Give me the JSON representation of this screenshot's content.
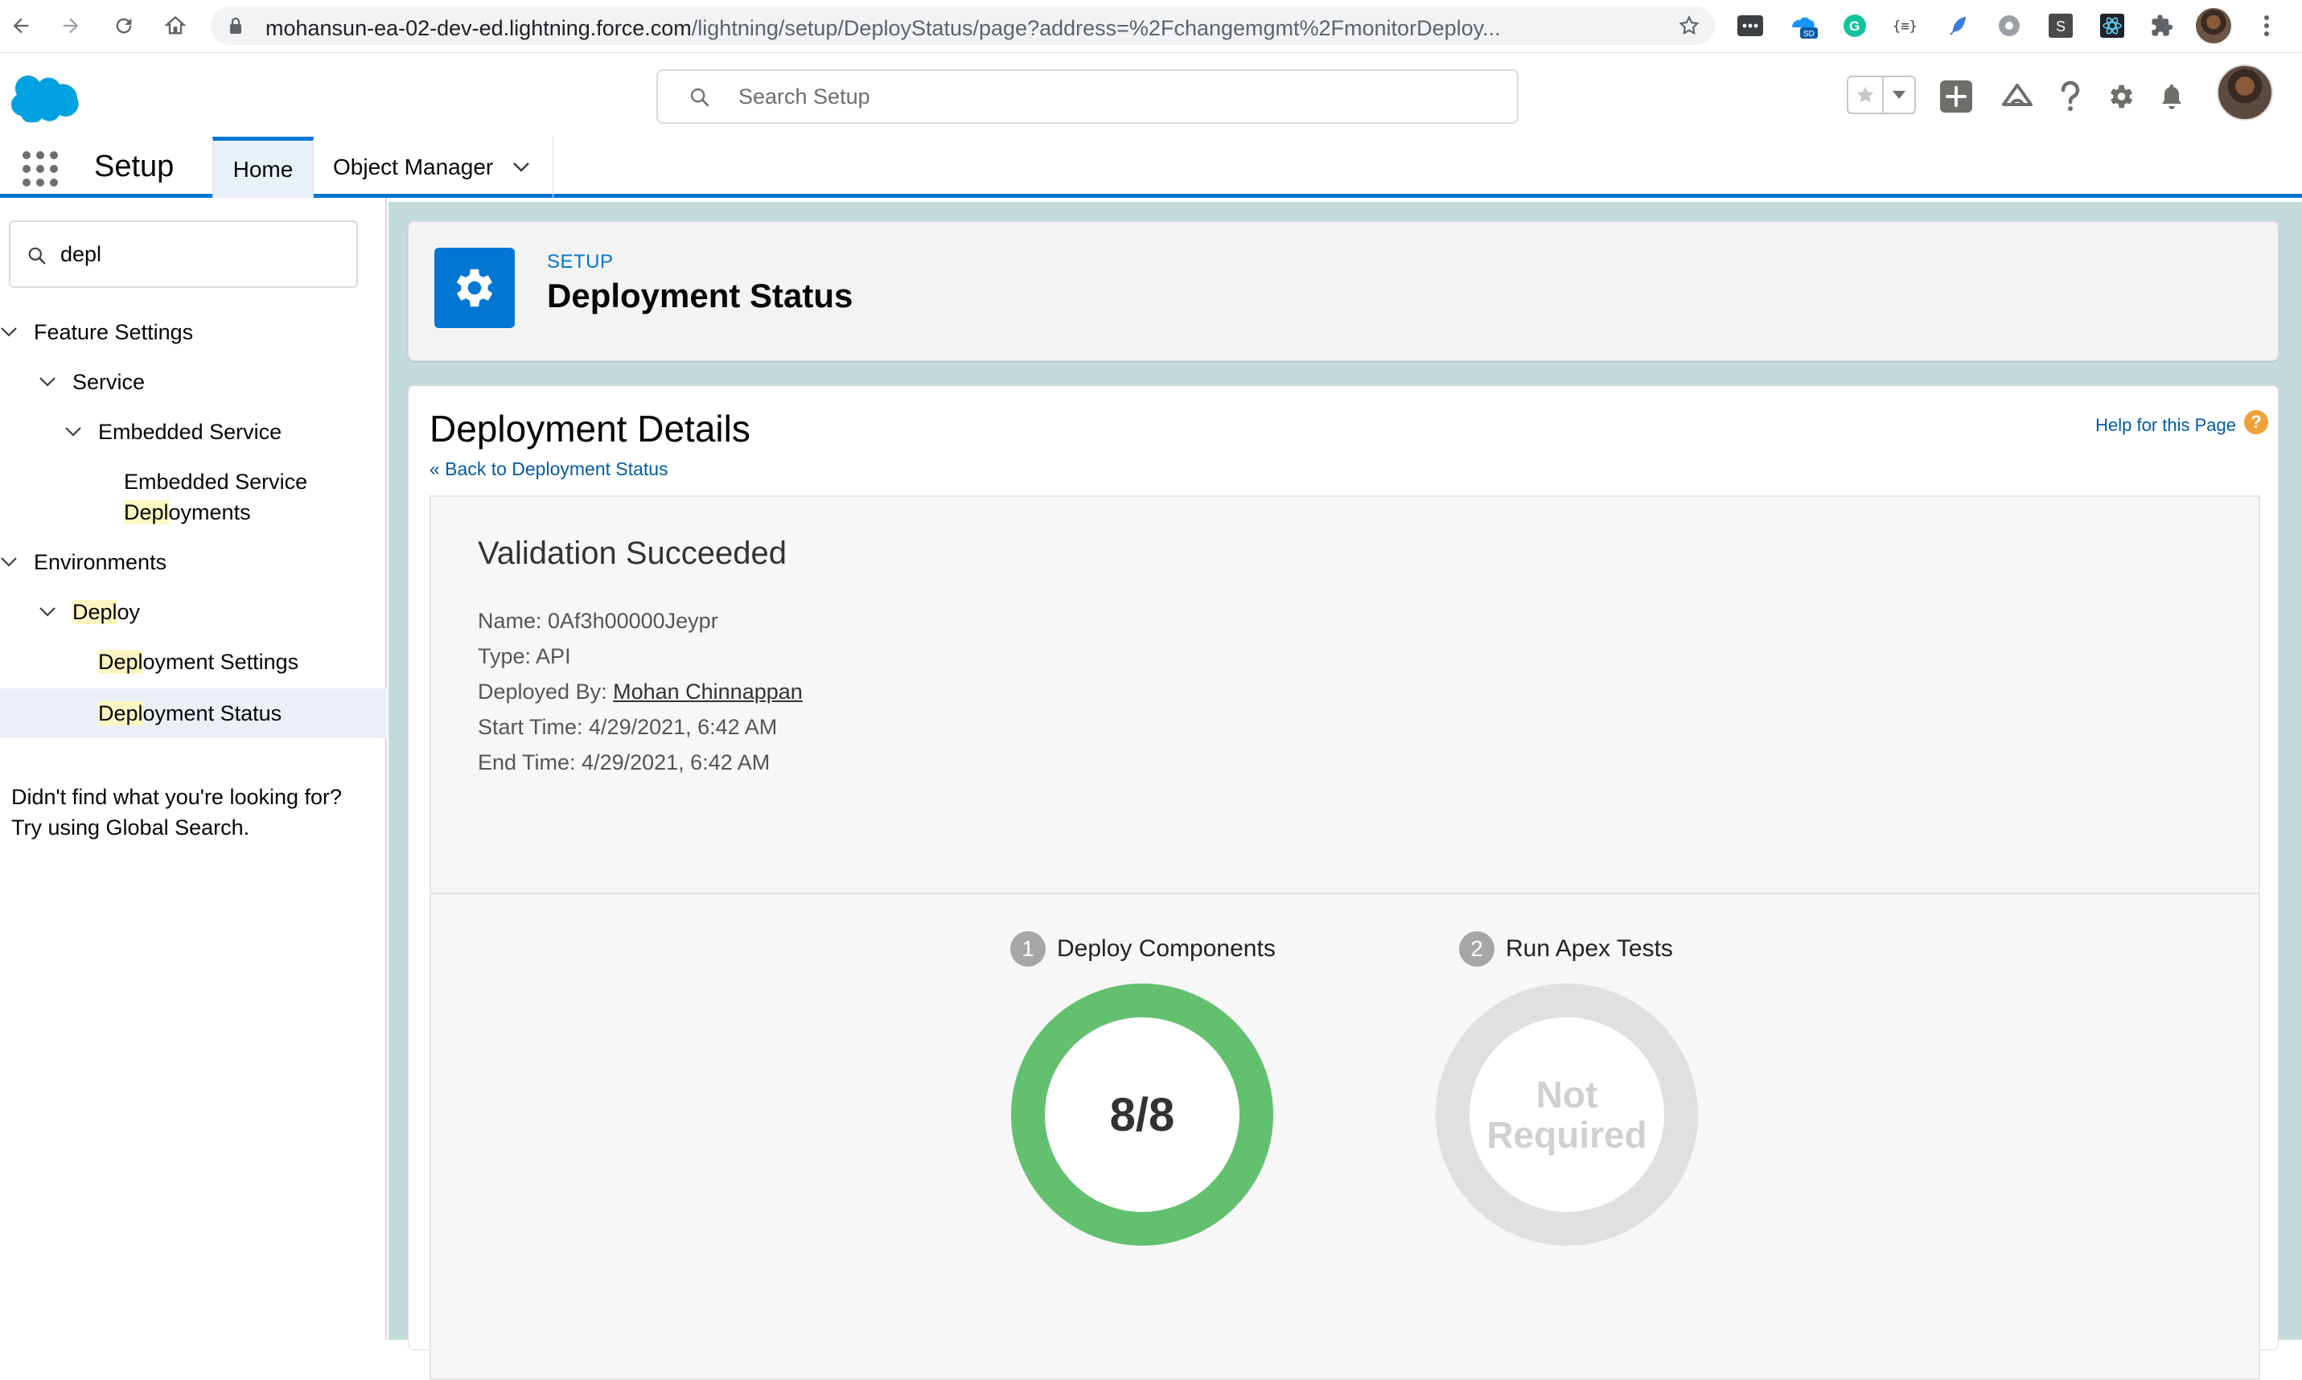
{
  "browser": {
    "url_host": "mohansun-ea-02-dev-ed.lightning.force.com",
    "url_path": "/lightning/setup/DeployStatus/page?address=%2Fchangemgmt%2FmonitorDeploy..."
  },
  "header": {
    "search_placeholder": "Search Setup"
  },
  "app_nav": {
    "app_name": "Setup",
    "tabs": [
      {
        "label": "Home",
        "active": true
      },
      {
        "label": "Object Manager",
        "active": false
      }
    ]
  },
  "sidebar": {
    "quick_find_value": "depl",
    "tree": {
      "feature_settings": "Feature Settings",
      "service": "Service",
      "embedded_service": "Embedded Service",
      "embedded_service_deployments_line1": "Embedded Service",
      "embedded_service_deployments_hl": "Depl",
      "embedded_service_deployments_rest": "oyments",
      "environments": "Environments",
      "deploy_hl": "Depl",
      "deploy_rest": "oy",
      "deployment_settings_hl": "Depl",
      "deployment_settings_rest": "oyment Settings",
      "deployment_status_hl": "Depl",
      "deployment_status_rest": "oyment Status"
    },
    "no_result_line1": "Didn't find what you're looking for?",
    "no_result_line2": "Try using Global Search."
  },
  "page_header": {
    "eyebrow": "SETUP",
    "title": "Deployment Status"
  },
  "detail": {
    "title": "Deployment Details",
    "back_link": "« Back to Deployment Status",
    "help_link": "Help for this Page",
    "help_badge": "?",
    "status_heading": "Validation Succeeded",
    "name": "Name: 0Af3h00000Jeypr",
    "type": "Type: API",
    "deployed_by_label": "Deployed By: ",
    "deployed_by_name": "Mohan Chinnappan",
    "start_time": "Start Time: 4/29/2021, 6:42 AM",
    "end_time": "End Time: 4/29/2021, 6:42 AM",
    "steps": [
      {
        "number": "1",
        "label": "Deploy Components",
        "result": "8/8",
        "progress": 1.0,
        "color": "#63c06f"
      },
      {
        "number": "2",
        "label": "Run Apex Tests",
        "result_line1": "Not",
        "result_line2": "Required",
        "progress": 0,
        "color": "#e0e0e0"
      }
    ]
  },
  "colors": {
    "brand_blue": "#0176d3",
    "highlight": "#fdf6c3",
    "success_green": "#63c06f",
    "content_background": "#c3dcd9"
  }
}
